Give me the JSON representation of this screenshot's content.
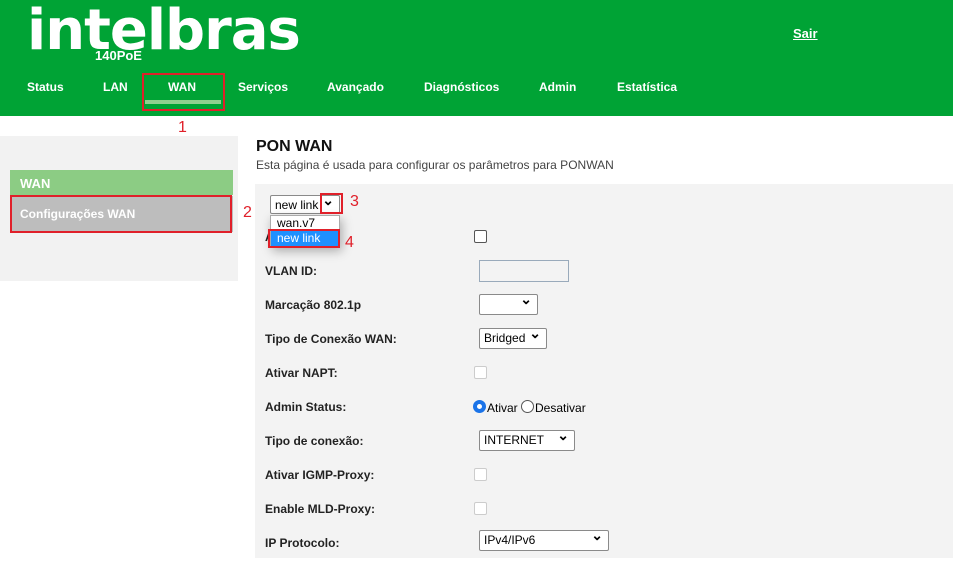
{
  "header": {
    "logo": "intelbras",
    "model": "140PoE",
    "logout": "Sair",
    "nav": [
      "Status",
      "LAN",
      "WAN",
      "Serviços",
      "Avançado",
      "Diagnósticos",
      "Admin",
      "Estatística"
    ],
    "active_nav": "WAN"
  },
  "sidebar": {
    "section": "WAN",
    "items": [
      {
        "label": "Configurações WAN",
        "active": true
      }
    ]
  },
  "page": {
    "title": "PON WAN",
    "description": "Esta página é usada para configurar os parâmetros para PONWAN"
  },
  "form": {
    "connection_select": {
      "value": "new link",
      "options": [
        "wan.v7",
        "new link"
      ],
      "highlighted": "new link"
    },
    "fields": [
      {
        "label": "Ativar VLAN:",
        "checked": false
      },
      {
        "label": "VLAN ID:",
        "value": ""
      },
      {
        "label": "Marcação 802.1p",
        "value": ""
      },
      {
        "label": "Tipo de Conexão WAN:",
        "value": "Bridged"
      },
      {
        "label": "Ativar NAPT:",
        "checked": false,
        "disabled": true
      },
      {
        "label": "Admin Status:",
        "options": [
          "Ativar",
          "Desativar"
        ],
        "selected": "Ativar"
      },
      {
        "label": "Tipo de conexão:",
        "value": "INTERNET"
      },
      {
        "label": "Ativar IGMP-Proxy:",
        "checked": false,
        "disabled": true
      },
      {
        "label": "Enable MLD-Proxy:",
        "checked": false,
        "disabled": true
      },
      {
        "label": "IP Protocolo:",
        "value": "IPv4/IPv6"
      }
    ]
  },
  "annotations": [
    "1",
    "2",
    "3",
    "4"
  ],
  "colors": {
    "brand": "#00a335",
    "annotation": "#e0202a",
    "highlight": "#1e90ff"
  }
}
